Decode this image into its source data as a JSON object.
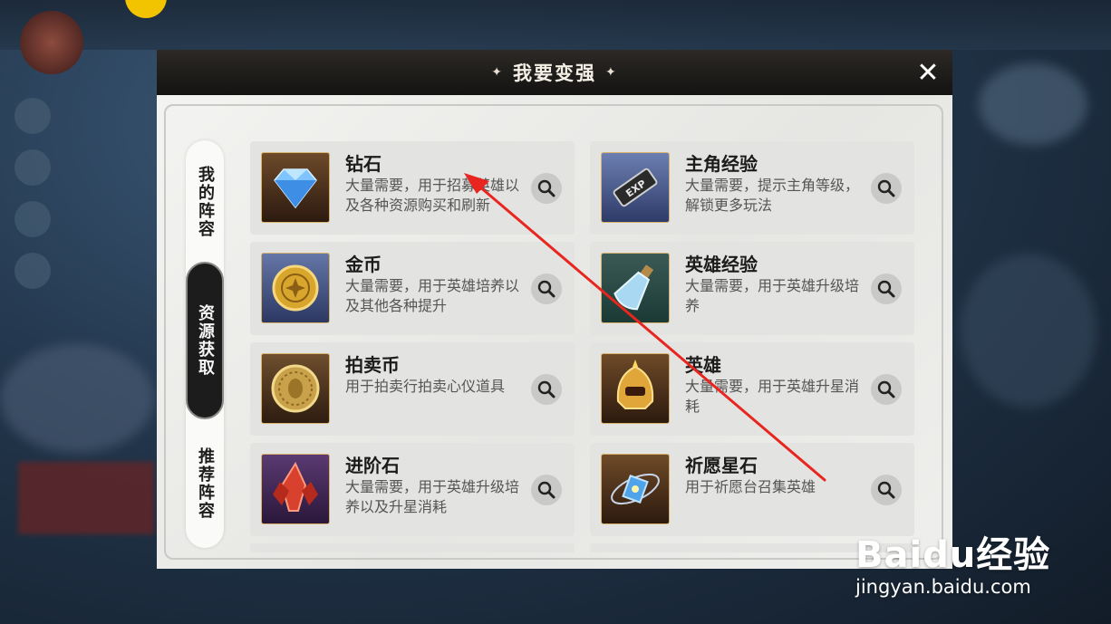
{
  "dialog": {
    "title": "我要变强",
    "close_glyph": "✕"
  },
  "tabs": [
    {
      "label": "我的阵容",
      "active": false
    },
    {
      "label": "资源获取",
      "active": true
    },
    {
      "label": "推荐阵容",
      "active": false
    }
  ],
  "resources": [
    {
      "name": "钻石",
      "desc": "大量需要，用于招募英雄以及各种资源购买和刷新",
      "icon": "diamond-icon"
    },
    {
      "name": "主角经验",
      "desc": "大量需要，提示主角等级，解锁更多玩法",
      "icon": "exp-ticket-icon"
    },
    {
      "name": "金币",
      "desc": "大量需要，用于英雄培养以及其他各种提升",
      "icon": "gold-coin-icon"
    },
    {
      "name": "英雄经验",
      "desc": "大量需要，用于英雄升级培养",
      "icon": "potion-icon"
    },
    {
      "name": "拍卖币",
      "desc": "用于拍卖行拍卖心仪道具",
      "icon": "auction-coin-icon"
    },
    {
      "name": "英雄",
      "desc": "大量需要，用于英雄升星消耗",
      "icon": "golden-helmet-icon"
    },
    {
      "name": "进阶石",
      "desc": "大量需要，用于英雄升级培养以及升星消耗",
      "icon": "red-crystal-icon"
    },
    {
      "name": "祈愿星石",
      "desc": "用于祈愿台召集英雄",
      "icon": "wish-star-stone-icon"
    }
  ],
  "watermark": {
    "brand": "Baidu经验",
    "url": "jingyan.baidu.com"
  },
  "colors": {
    "title_bar": "#1e1c1a",
    "panel": "#ececea",
    "card": "#e3e3e1",
    "active_tab": "#1c1c1c",
    "annotation_arrow": "#e8261f",
    "card_border_gold": "#d8b16a"
  }
}
